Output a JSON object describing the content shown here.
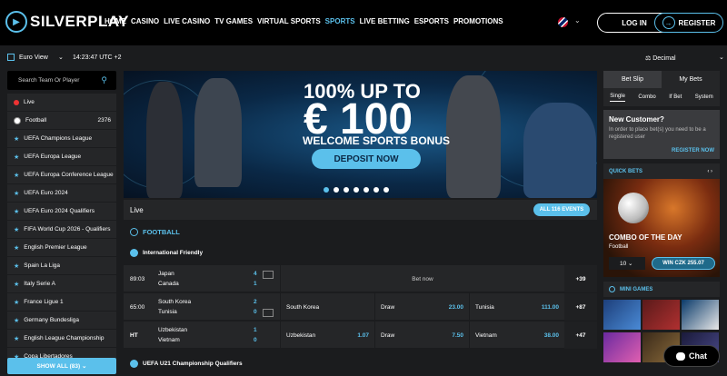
{
  "header": {
    "logo_text": "SILVERPLAY",
    "nav": [
      {
        "label": "HOME",
        "active": false
      },
      {
        "label": "CASINO",
        "active": false
      },
      {
        "label": "LIVE CASINO",
        "active": false
      },
      {
        "label": "TV GAMES",
        "active": false
      },
      {
        "label": "VIRTUAL SPORTS",
        "active": false
      },
      {
        "label": "SPORTS",
        "active": true
      },
      {
        "label": "LIVE BETTING",
        "active": false
      },
      {
        "label": "ESPORTS",
        "active": false
      },
      {
        "label": "PROMOTIONS",
        "active": false
      }
    ],
    "login_label": "LOG IN",
    "register_label": "REGISTER"
  },
  "subbar": {
    "view_label": "Euro View",
    "clock": "14:23:47 UTC +2",
    "odds_format": "Decimal"
  },
  "sidebar": {
    "search_placeholder": "Search Team Or Player",
    "live_label": "Live",
    "football_label": "Football",
    "football_count": "2376",
    "leagues": [
      "UEFA Champions League",
      "UEFA Europa League",
      "UEFA Europa Conference League",
      "UEFA Euro 2024",
      "UEFA Euro 2024 Qualifiers",
      "FIFA World Cup 2026 - Qualifiers",
      "English Premier League",
      "Spain La Liga",
      "Italy Serie A",
      "France Ligue 1",
      "Germany Bundesliga",
      "English League Championship",
      "Copa Libertadores"
    ],
    "show_all_label": "SHOW ALL (83)"
  },
  "banner": {
    "title": "100% UP TO",
    "amount": "€ 100",
    "subtitle": "WELCOME SPORTS BONUS",
    "cta": "DEPOSIT NOW",
    "slide_count": 7,
    "active_slide": 0
  },
  "live": {
    "label": "Live",
    "all_events_label": "ALL 116 EVENTS",
    "sport_label": "FOOTBALL",
    "league_label": "International Friendly",
    "matches": [
      {
        "time": "89:03",
        "team1": "Japan",
        "team2": "Canada",
        "score1": "4",
        "score2": "1",
        "bet_now": "Bet now",
        "more": "+39"
      },
      {
        "time": "65:00",
        "team1": "South Korea",
        "team2": "Tunisia",
        "score1": "2",
        "score2": "0",
        "o1_label": "South Korea",
        "o1": "",
        "ox_label": "Draw",
        "ox": "23.00",
        "o2_label": "Tunisia",
        "o2": "111.00",
        "more": "+87"
      },
      {
        "time": "HT",
        "team1": "Uzbekistan",
        "team2": "Vietnam",
        "score1": "1",
        "score2": "0",
        "o1_label": "Uzbekistan",
        "o1": "1.07",
        "ox_label": "Draw",
        "ox": "7.50",
        "o2_label": "Vietnam",
        "o2": "38.00",
        "more": "+47"
      }
    ],
    "next_league_label": "UEFA U21 Championship Qualifiers"
  },
  "betslip": {
    "tab_betslip": "Bet Slip",
    "tab_mybets": "My Bets",
    "subtabs": [
      "Single",
      "Combo",
      "If Bet",
      "System"
    ],
    "new_customer_title": "New Customer?",
    "new_customer_text": "In order to place bet(s) you need to be a registered user",
    "register_now": "REGISTER NOW"
  },
  "quick_bets": {
    "label": "QUICK BETS",
    "combo_title": "COMBO OF THE DAY",
    "combo_sport": "Football",
    "stake": "10",
    "win_label": "WIN CZK 255.07"
  },
  "mini_games": {
    "label": "MINI GAMES"
  },
  "chat_label": "Chat",
  "colors": {
    "accent": "#5bc0eb",
    "background": "#1b1c1e",
    "panel": "#252628"
  }
}
